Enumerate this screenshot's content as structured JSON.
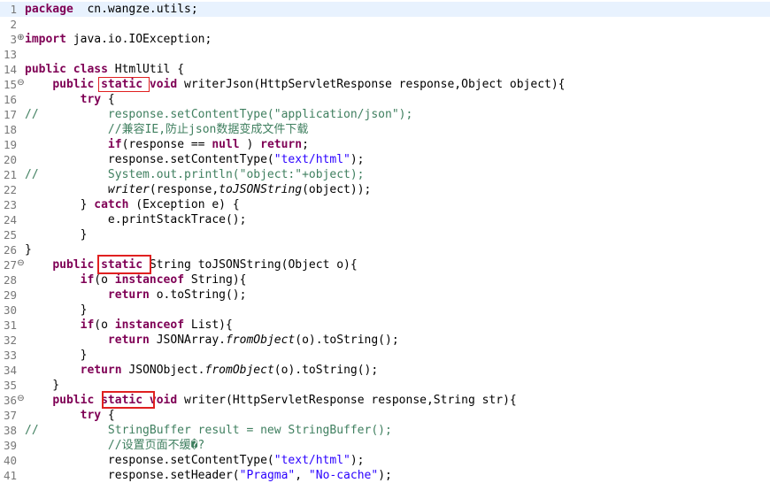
{
  "editor": {
    "language": "java",
    "current_line": 1,
    "highlight_color": "#e02020",
    "highlight_word": "static",
    "lines": [
      {
        "n": "1",
        "fold": "",
        "segs": [
          [
            "kw",
            "package"
          ],
          [
            "",
            "  cn.wangze.utils;"
          ]
        ]
      },
      {
        "n": "2",
        "fold": "",
        "segs": []
      },
      {
        "n": "3",
        "fold": "plus",
        "segs": [
          [
            "kw",
            "import"
          ],
          [
            "",
            " java.io.IOException;"
          ]
        ]
      },
      {
        "n": "13",
        "fold": "",
        "segs": []
      },
      {
        "n": "14",
        "fold": "",
        "segs": [
          [
            "kw",
            "public class"
          ],
          [
            "",
            " HtmlUtil {"
          ]
        ]
      },
      {
        "n": "15",
        "fold": "minus",
        "segs": [
          [
            "",
            "    "
          ],
          [
            "kw",
            "public"
          ],
          [
            "",
            " "
          ],
          [
            "kw",
            "static"
          ],
          [
            "",
            " "
          ],
          [
            "kw",
            "void"
          ],
          [
            "",
            " writerJson(HttpServletResponse response,Object object){"
          ]
        ]
      },
      {
        "n": "16",
        "fold": "",
        "segs": [
          [
            "",
            "        "
          ],
          [
            "kw",
            "try"
          ],
          [
            "",
            " {"
          ]
        ]
      },
      {
        "n": "17",
        "fold": "",
        "segs": [
          [
            "cm",
            "//          response.setContentType(\"application/json\");"
          ]
        ]
      },
      {
        "n": "18",
        "fold": "",
        "segs": [
          [
            "",
            "            "
          ],
          [
            "cm",
            "//兼容IE,防止json数据变成文件下载"
          ]
        ]
      },
      {
        "n": "19",
        "fold": "",
        "segs": [
          [
            "",
            "            "
          ],
          [
            "kw",
            "if"
          ],
          [
            "",
            "(response == "
          ],
          [
            "kw",
            "null"
          ],
          [
            "",
            " ) "
          ],
          [
            "kw",
            "return"
          ],
          [
            "",
            ";"
          ]
        ]
      },
      {
        "n": "20",
        "fold": "",
        "segs": [
          [
            "",
            "            response.setContentType("
          ],
          [
            "str",
            "\"text/html\""
          ],
          [
            "",
            ");"
          ]
        ]
      },
      {
        "n": "21",
        "fold": "",
        "segs": [
          [
            "cm",
            "//          System.out.println(\"object:\"+object);"
          ]
        ]
      },
      {
        "n": "22",
        "fold": "",
        "segs": [
          [
            "",
            "            "
          ],
          [
            "it",
            "writer"
          ],
          [
            "",
            "(response,"
          ],
          [
            "it",
            "toJSONString"
          ],
          [
            "",
            "(object));"
          ]
        ]
      },
      {
        "n": "23",
        "fold": "",
        "segs": [
          [
            "",
            "        } "
          ],
          [
            "kw",
            "catch"
          ],
          [
            "",
            " (Exception e) {"
          ]
        ]
      },
      {
        "n": "24",
        "fold": "",
        "segs": [
          [
            "",
            "            e.printStackTrace();"
          ]
        ]
      },
      {
        "n": "25",
        "fold": "",
        "segs": [
          [
            "",
            "        }"
          ]
        ]
      },
      {
        "n": "26",
        "fold": "",
        "segs": [
          [
            "",
            "}"
          ]
        ]
      },
      {
        "n": "27",
        "fold": "minus",
        "segs": [
          [
            "",
            "    "
          ],
          [
            "kw",
            "public"
          ],
          [
            "",
            " "
          ],
          [
            "kw",
            "static"
          ],
          [
            "",
            " String toJSONString(Object o){"
          ]
        ]
      },
      {
        "n": "28",
        "fold": "",
        "segs": [
          [
            "",
            "        "
          ],
          [
            "kw",
            "if"
          ],
          [
            "",
            "(o "
          ],
          [
            "kw",
            "instanceof"
          ],
          [
            "",
            " String){"
          ]
        ]
      },
      {
        "n": "29",
        "fold": "",
        "segs": [
          [
            "",
            "            "
          ],
          [
            "kw",
            "return"
          ],
          [
            "",
            " o.toString();"
          ]
        ]
      },
      {
        "n": "30",
        "fold": "",
        "segs": [
          [
            "",
            "        }"
          ]
        ]
      },
      {
        "n": "31",
        "fold": "",
        "segs": [
          [
            "",
            "        "
          ],
          [
            "kw",
            "if"
          ],
          [
            "",
            "(o "
          ],
          [
            "kw",
            "instanceof"
          ],
          [
            "",
            " List){"
          ]
        ]
      },
      {
        "n": "32",
        "fold": "",
        "segs": [
          [
            "",
            "            "
          ],
          [
            "kw",
            "return"
          ],
          [
            "",
            " JSONArray."
          ],
          [
            "it",
            "fromObject"
          ],
          [
            "",
            "(o).toString();"
          ]
        ]
      },
      {
        "n": "33",
        "fold": "",
        "segs": [
          [
            "",
            "        }"
          ]
        ]
      },
      {
        "n": "34",
        "fold": "",
        "segs": [
          [
            "",
            "        "
          ],
          [
            "kw",
            "return"
          ],
          [
            "",
            " JSONObject."
          ],
          [
            "it",
            "fromObject"
          ],
          [
            "",
            "(o).toString();"
          ]
        ]
      },
      {
        "n": "35",
        "fold": "",
        "segs": [
          [
            "",
            "    }"
          ]
        ]
      },
      {
        "n": "36",
        "fold": "minus",
        "segs": [
          [
            "",
            "    "
          ],
          [
            "kw",
            "public"
          ],
          [
            "",
            " "
          ],
          [
            "kw",
            "static"
          ],
          [
            "",
            " "
          ],
          [
            "kw",
            "void"
          ],
          [
            "",
            " writer(HttpServletResponse response,String str){"
          ]
        ]
      },
      {
        "n": "37",
        "fold": "",
        "segs": [
          [
            "",
            "        "
          ],
          [
            "kw",
            "try"
          ],
          [
            "",
            " {"
          ]
        ]
      },
      {
        "n": "38",
        "fold": "",
        "segs": [
          [
            "cm",
            "//          StringBuffer result = new StringBuffer();"
          ]
        ]
      },
      {
        "n": "39",
        "fold": "",
        "segs": [
          [
            "",
            "            "
          ],
          [
            "cm",
            "//设置页面不缓�?"
          ]
        ]
      },
      {
        "n": "40",
        "fold": "",
        "segs": [
          [
            "",
            "            response.setContentType("
          ],
          [
            "str",
            "\"text/html\""
          ],
          [
            "",
            ");"
          ]
        ]
      },
      {
        "n": "41",
        "fold": "",
        "segs": [
          [
            "",
            "            response.setHeader("
          ],
          [
            "str",
            "\"Pragma\""
          ],
          [
            "",
            ", "
          ],
          [
            "str",
            "\"No-cache\""
          ],
          [
            "",
            ");"
          ]
        ]
      }
    ]
  }
}
